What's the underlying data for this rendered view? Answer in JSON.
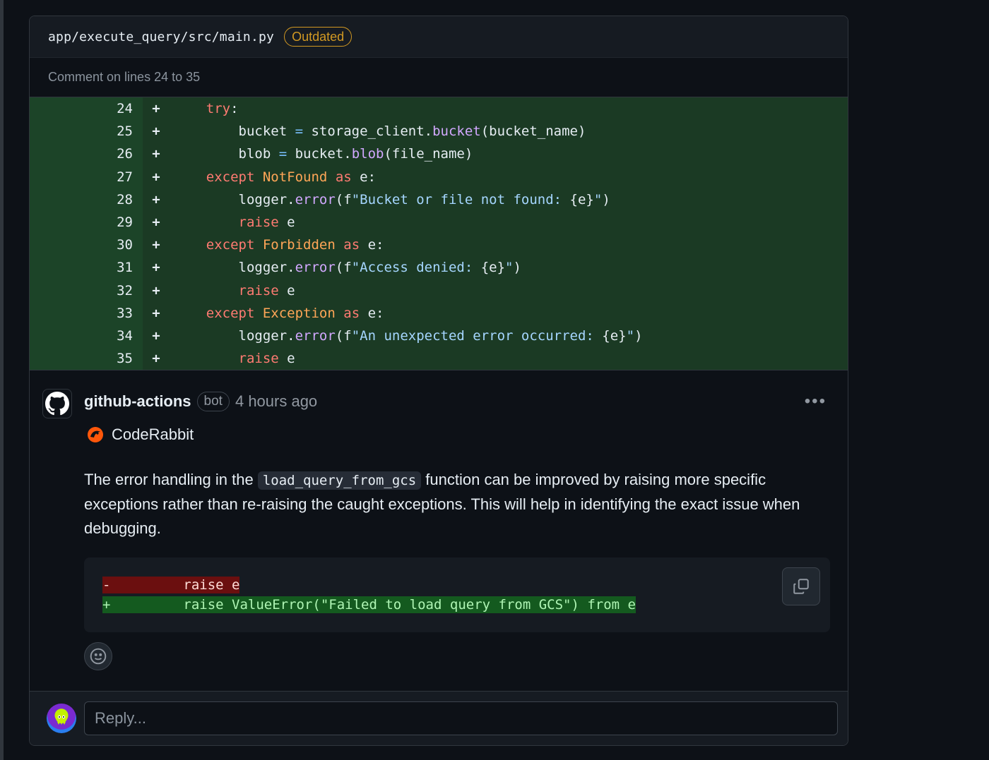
{
  "file": {
    "path": "app/execute_query/src/main.py",
    "badge": "Outdated"
  },
  "comment_range": "Comment on lines 24 to 35",
  "diff_lines": [
    {
      "num": "24",
      "sign": "+"
    },
    {
      "num": "25",
      "sign": "+"
    },
    {
      "num": "26",
      "sign": "+"
    },
    {
      "num": "27",
      "sign": "+"
    },
    {
      "num": "28",
      "sign": "+"
    },
    {
      "num": "29",
      "sign": "+"
    },
    {
      "num": "30",
      "sign": "+"
    },
    {
      "num": "31",
      "sign": "+"
    },
    {
      "num": "32",
      "sign": "+"
    },
    {
      "num": "33",
      "sign": "+"
    },
    {
      "num": "34",
      "sign": "+"
    },
    {
      "num": "35",
      "sign": "+"
    }
  ],
  "code": {
    "l24": {
      "indent": "    ",
      "kw": "try",
      "rest": ":"
    },
    "l25": {
      "a": "        bucket ",
      "op": "=",
      "b": " storage_client.",
      "fn": "bucket",
      "c": "(bucket_name)"
    },
    "l26": {
      "a": "        blob ",
      "op": "=",
      "b": " bucket.",
      "fn": "blob",
      "c": "(file_name)"
    },
    "l27": {
      "indent": "    ",
      "kw": "except",
      "cls": "NotFound",
      "as": "as",
      "rest": " e:"
    },
    "l28": {
      "a": "        logger.",
      "fn": "error",
      "b": "(f",
      "str": "\"Bucket or file not found: ",
      "var": "{e}",
      "str2": "\"",
      "c": ")"
    },
    "l29": {
      "indent": "        ",
      "kw": "raise",
      "rest": " e"
    },
    "l30": {
      "indent": "    ",
      "kw": "except",
      "cls": "Forbidden",
      "as": "as",
      "rest": " e:"
    },
    "l31": {
      "a": "        logger.",
      "fn": "error",
      "b": "(f",
      "str": "\"Access denied: ",
      "var": "{e}",
      "str2": "\"",
      "c": ")"
    },
    "l32": {
      "indent": "        ",
      "kw": "raise",
      "rest": " e"
    },
    "l33": {
      "indent": "    ",
      "kw": "except",
      "cls": "Exception",
      "as": "as",
      "rest": " e:"
    },
    "l34": {
      "a": "        logger.",
      "fn": "error",
      "b": "(f",
      "str": "\"An unexpected error occurred: ",
      "var": "{e}",
      "str2": "\"",
      "c": ")"
    },
    "l35": {
      "indent": "        ",
      "kw": "raise",
      "rest": " e"
    }
  },
  "comment": {
    "author": "github-actions",
    "bot_label": "bot",
    "time": "4 hours ago",
    "more": "•••",
    "brand": "CodeRabbit",
    "text_before": "The error handling in the ",
    "inline_code": "load_query_from_gcs",
    "text_after": " function can be improved by raising more specific exceptions rather than re-raising the caught exceptions. This will help in identifying the exact issue when debugging.",
    "suggestion_del": "-         raise e",
    "suggestion_add": "+         raise ValueError(\"Failed to load query from GCS\") from e"
  },
  "reply": {
    "placeholder": "Reply..."
  },
  "icons": {
    "avatar": "github-icon",
    "brand": "coderabbit-icon",
    "copy": "copy-icon",
    "emoji": "smiley-icon",
    "more": "kebab-horizontal-icon"
  },
  "colors": {
    "background": "#0d1117",
    "diff_added_bg": "#1b3a24",
    "outdated": "#d29922",
    "keyword": "#ff7b72",
    "class": "#ffa657",
    "function": "#d2a8ff",
    "string": "#a5d6ff"
  }
}
